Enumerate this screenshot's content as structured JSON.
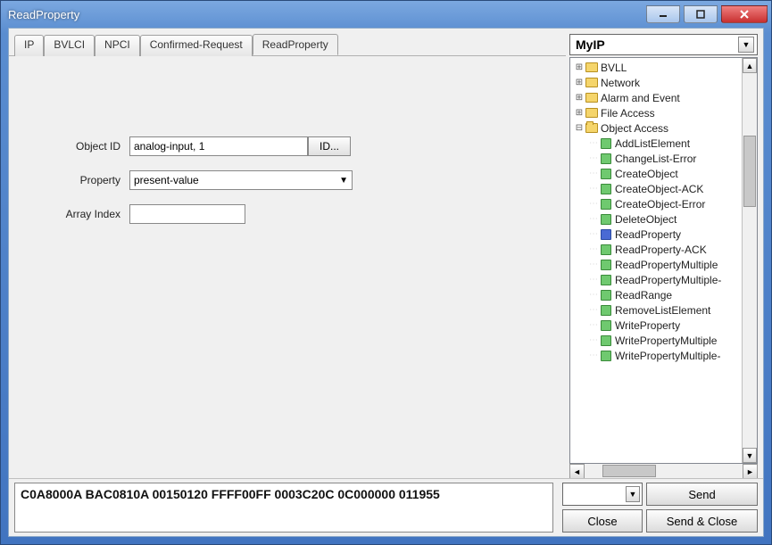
{
  "window": {
    "title": "ReadProperty"
  },
  "tabs": {
    "items": [
      {
        "label": "IP"
      },
      {
        "label": "BVLCI"
      },
      {
        "label": "NPCI"
      },
      {
        "label": "Confirmed-Request"
      },
      {
        "label": "ReadProperty",
        "active": true
      }
    ]
  },
  "form": {
    "object_id_label": "Object ID",
    "object_id_value": "analog-input, 1",
    "id_button": "ID...",
    "property_label": "Property",
    "property_value": "present-value",
    "array_index_label": "Array Index",
    "array_index_value": ""
  },
  "right": {
    "combo_value": "MyIP",
    "tree": {
      "folders": [
        {
          "label": "BVLL"
        },
        {
          "label": "Network"
        },
        {
          "label": "Alarm and Event"
        },
        {
          "label": "File Access"
        }
      ],
      "open_folder": {
        "label": "Object Access"
      },
      "items": [
        {
          "label": "AddListElement"
        },
        {
          "label": "ChangeList-Error"
        },
        {
          "label": "CreateObject"
        },
        {
          "label": "CreateObject-ACK"
        },
        {
          "label": "CreateObject-Error"
        },
        {
          "label": "DeleteObject"
        },
        {
          "label": "ReadProperty",
          "selected": true
        },
        {
          "label": "ReadProperty-ACK"
        },
        {
          "label": "ReadPropertyMultiple"
        },
        {
          "label": "ReadPropertyMultiple-"
        },
        {
          "label": "ReadRange"
        },
        {
          "label": "RemoveListElement"
        },
        {
          "label": "WriteProperty"
        },
        {
          "label": "WritePropertyMultiple"
        },
        {
          "label": "WritePropertyMultiple-"
        }
      ]
    }
  },
  "bottom": {
    "hex": "C0A8000A BAC0810A 00150120 FFFF00FF 0003C20C 0C000000 011955",
    "send": "Send",
    "close": "Close",
    "send_close": "Send & Close"
  }
}
